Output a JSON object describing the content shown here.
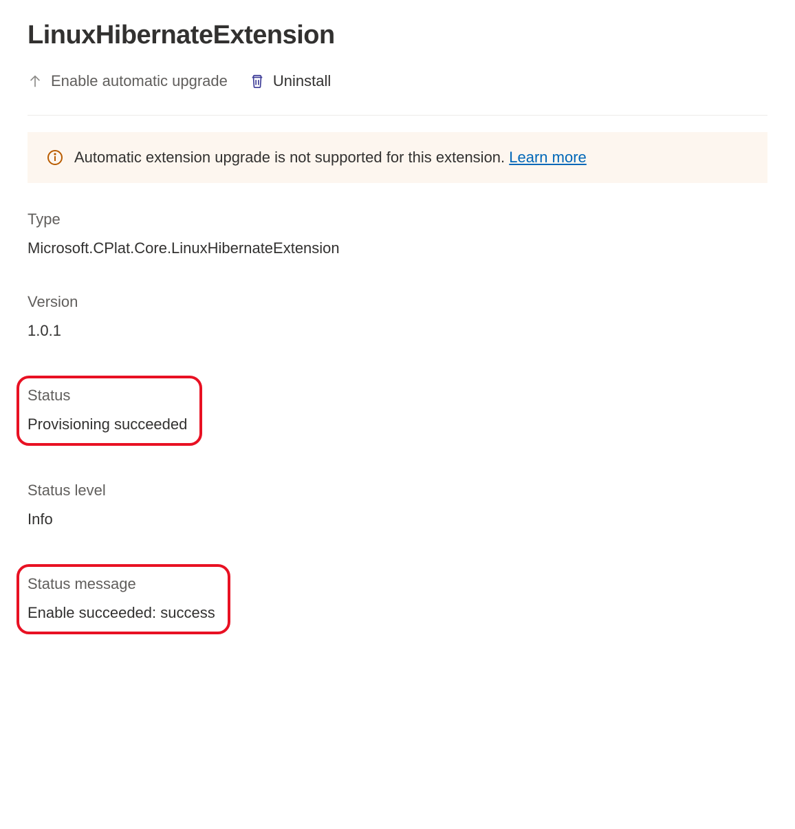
{
  "title": "LinuxHibernateExtension",
  "toolbar": {
    "enable_auto_upgrade_label": "Enable automatic upgrade",
    "uninstall_label": "Uninstall"
  },
  "banner": {
    "message": "Automatic extension upgrade is not supported for this extension. ",
    "link_label": "Learn more"
  },
  "fields": {
    "type": {
      "label": "Type",
      "value": "Microsoft.CPlat.Core.LinuxHibernateExtension"
    },
    "version": {
      "label": "Version",
      "value": "1.0.1"
    },
    "status": {
      "label": "Status",
      "value": "Provisioning succeeded"
    },
    "status_level": {
      "label": "Status level",
      "value": "Info"
    },
    "status_message": {
      "label": "Status message",
      "value": "Enable succeeded: success"
    }
  }
}
